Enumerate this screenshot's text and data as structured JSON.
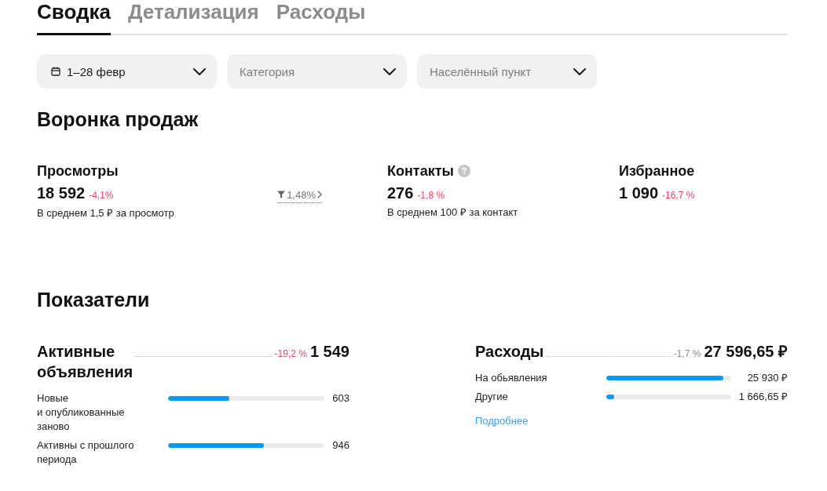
{
  "tabs": [
    {
      "label": "Сводка",
      "selected": true
    },
    {
      "label": "Детализация",
      "selected": false
    },
    {
      "label": "Расходы",
      "selected": false
    }
  ],
  "filters": [
    {
      "kind": "date",
      "value": "1–28 февр"
    },
    {
      "kind": "select",
      "placeholder": "Категория"
    },
    {
      "kind": "select",
      "placeholder": "Населённый пункт"
    }
  ],
  "funnel": {
    "title": "Воронка продаж",
    "stages": [
      {
        "label": "Просмотры",
        "help": false,
        "value": "18 592",
        "change": "-4,1%",
        "negative": true,
        "conversion": "1,48%",
        "note": "В среднем 1,5 ₽ за просмотр"
      },
      {
        "label": "Контакты",
        "help": true,
        "value": "276",
        "change": "-1,8 %",
        "negative": true,
        "note": "В среднем 100 ₽ за контакт"
      },
      {
        "label": "Избранное",
        "help": false,
        "value": "1 090",
        "change": "-16,7 %",
        "negative": true
      }
    ]
  },
  "metrics": {
    "title": "Показатели",
    "cards": [
      {
        "title": "Активные объявления",
        "change": "-19,2 %",
        "negative": true,
        "total": "1 549",
        "rows": [
          {
            "label": "Новые и опубликованные заново",
            "level": 0.39,
            "value": "603"
          },
          {
            "label": "Активны с прошлого периода",
            "level": 0.61,
            "value": "946"
          }
        ]
      },
      {
        "title": "Расходы",
        "change": "-1,7 %",
        "negative": false,
        "total": "27 596,65 ₽",
        "rows": [
          {
            "label": "На обьявления",
            "level": 0.94,
            "value": "25 930 ₽"
          },
          {
            "label": "Другие",
            "level": 0.06,
            "value": "1 666,65 ₽"
          }
        ],
        "link": "Подробнее"
      }
    ]
  }
}
